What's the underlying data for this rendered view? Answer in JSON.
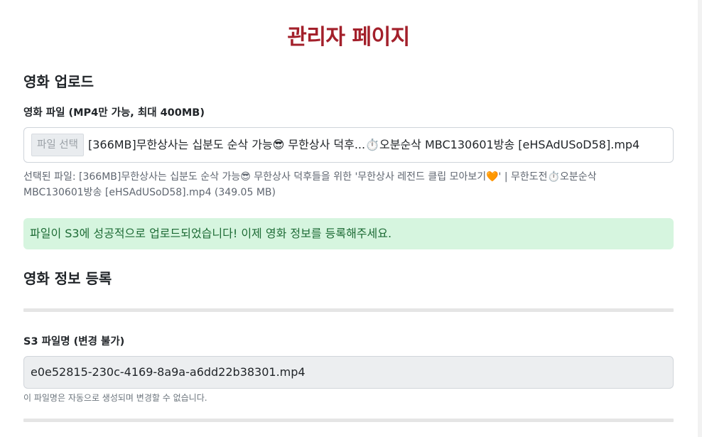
{
  "page": {
    "title": "관리자 페이지"
  },
  "upload": {
    "section_title": "영화 업로드",
    "file_label": "영화 파일 (MP4만 가능, 최대 400MB)",
    "file_button": "파일 선택",
    "file_name_display": "[366MB]무한상사는 십분도 순삭 가능😎 무한상사 덕후...⏱️오분순삭 MBC130601방송 [eHSAdUSoD58].mp4",
    "selected_info": "선택된 파일: [366MB]무한상사는 십분도 순삭 가능😎 무한상사 덕후들을 위한 '무한상사 레전드 클립 모아보기🧡' | 무한도전⏱️오분순삭 MBC130601방송 [eHSAdUSoD58].mp4 (349.05 MB)",
    "success_message": "파일이 S3에 성공적으로 업로드되었습니다! 이제 영화 정보를 등록해주세요."
  },
  "movie_info": {
    "section_title": "영화 정보 등록",
    "s3_label": "S3 파일명 (변경 불가)",
    "s3_value": "e0e52815-230c-4169-8a9a-a6dd22b38301.mp4",
    "s3_help": "이 파일명은 자동으로 생성되며 변경할 수 없습니다."
  },
  "colors": {
    "title": "#a3202b",
    "success_bg": "#d6f5df",
    "success_text": "#1d6b35"
  }
}
